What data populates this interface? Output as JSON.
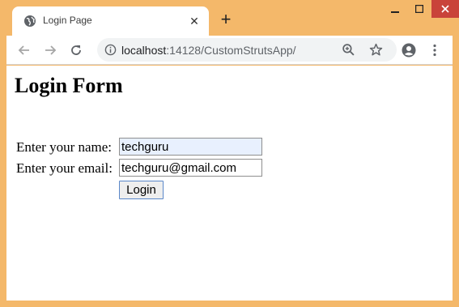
{
  "tab": {
    "title": "Login Page",
    "close_glyph": "✕",
    "favicon": "globe-icon"
  },
  "new_tab_glyph": "+",
  "window": {
    "accent": "#f4b86a",
    "close_color": "#c9433a"
  },
  "address": {
    "host": "localhost",
    "rest": ":14128/CustomStrutsApp/"
  },
  "page": {
    "heading": "Login Form",
    "name_label": "Enter your name:",
    "name_value": "techguru",
    "email_label": "Enter your email:",
    "email_value": "techguru@gmail.com",
    "submit_label": "Login"
  }
}
